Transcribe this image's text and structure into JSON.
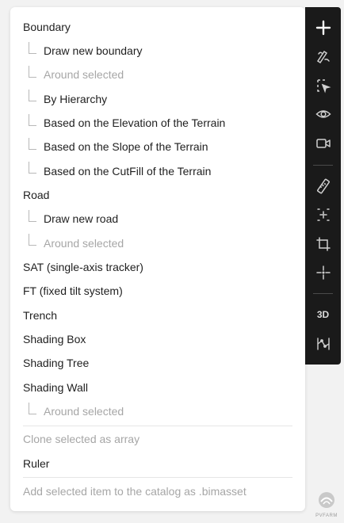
{
  "menu": {
    "boundary": "Boundary",
    "draw_new_boundary": "Draw new boundary",
    "boundary_around_selected": "Around selected",
    "by_hierarchy": "By Hierarchy",
    "elevation": "Based on the Elevation of the Terrain",
    "slope": "Based on the Slope of the Terrain",
    "cutfill": "Based on the CutFill of the Terrain",
    "road": "Road",
    "draw_new_road": "Draw new road",
    "road_around_selected": "Around selected",
    "sat": "SAT (single-axis tracker)",
    "ft": "FT (fixed tilt system)",
    "trench": "Trench",
    "shading_box": "Shading Box",
    "shading_tree": "Shading Tree",
    "shading_wall": "Shading Wall",
    "wall_around_selected": "Around selected",
    "clone_array": "Clone selected as array",
    "ruler": "Ruler",
    "add_to_catalog": "Add selected item to the catalog as .bimasset"
  },
  "toolbar": {
    "three_d_label": "3D",
    "icons": [
      "plus-icon",
      "draw-pen-icon",
      "select-cursor-icon",
      "eye-icon",
      "video-camera-icon",
      "ruler-icon",
      "sparkle-select-icon",
      "crop-icon",
      "crosshair-icon",
      "3d-label",
      "scatter-icon"
    ]
  },
  "logo": {
    "text": "PVFARM"
  }
}
